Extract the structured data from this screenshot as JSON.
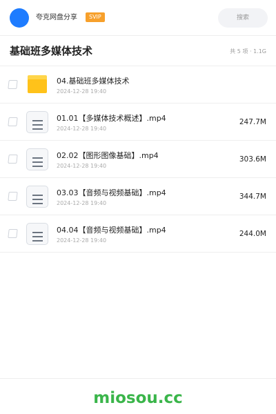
{
  "header": {
    "username": "夸克网盘分享",
    "badge": "SVIP",
    "search_label": "搜索"
  },
  "folder_header": {
    "title": "基础班多媒体技术",
    "summary": "共 5 项 · 1.1G"
  },
  "files": [
    {
      "name": "04.基础班多媒体技术",
      "date": "2024-12-28 19:40",
      "size": "",
      "icon": "folder-icon"
    },
    {
      "name": "01.01【多媒体技术概述】.mp4",
      "date": "2024-12-28 19:40",
      "size": "247.7M",
      "icon": "video-file-icon"
    },
    {
      "name": "02.02【图形图像基础】.mp4",
      "date": "2024-12-28 19:40",
      "size": "303.6M",
      "icon": "video-file-icon"
    },
    {
      "name": "03.03【音频与视频基础】.mp4",
      "date": "2024-12-28 19:40",
      "size": "344.7M",
      "icon": "video-file-icon"
    },
    {
      "name": "04.04【音频与视频基础】.mp4",
      "date": "2024-12-28 19:40",
      "size": "244.0M",
      "icon": "video-file-icon"
    }
  ],
  "footer": {
    "watermark": "miosou.cc"
  },
  "colors": {
    "accent_blue": "#1e7cff",
    "svip_orange": "#f7a02b",
    "folder_yellow": "#ffc21a",
    "watermark_green": "#3ab54a"
  }
}
